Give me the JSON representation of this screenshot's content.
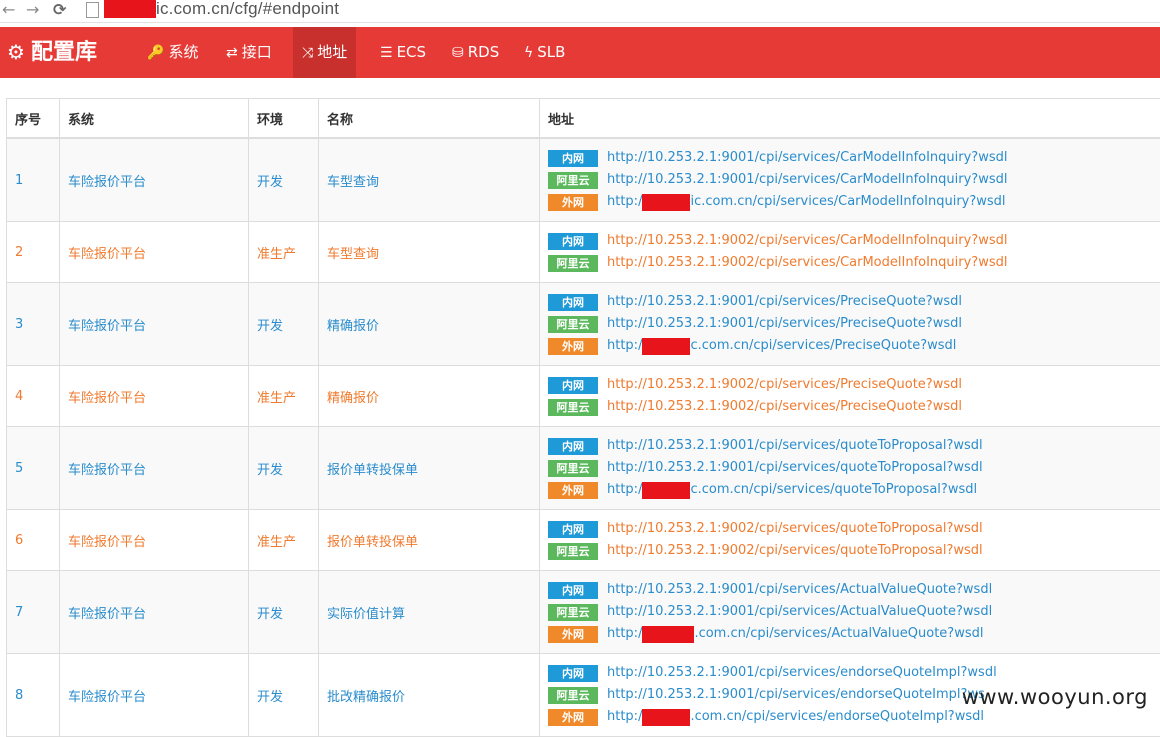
{
  "browser": {
    "url": "ic.com.cn/cfg/#endpoint",
    "back_glyph": "←",
    "forward_glyph": "→",
    "reload_glyph": "⟳"
  },
  "navbar": {
    "brand": "配置库",
    "items": [
      {
        "label": "系统",
        "icon": "key-icon",
        "glyph": "🔑"
      },
      {
        "label": "接口",
        "icon": "exchange-icon",
        "glyph": "⇄"
      },
      {
        "label": "地址",
        "icon": "random-icon",
        "glyph": "⤨"
      },
      {
        "label": "ECS",
        "icon": "server-icon",
        "glyph": "☰"
      },
      {
        "label": "RDS",
        "icon": "database-icon",
        "glyph": "⛁"
      },
      {
        "label": "SLB",
        "icon": "bolt-icon",
        "glyph": "ϟ"
      }
    ]
  },
  "table": {
    "headers": [
      "序号",
      "系统",
      "环境",
      "名称",
      "地址"
    ],
    "badges": {
      "intranet": "内网",
      "aliyun": "阿里云",
      "public": "外网"
    },
    "rows": [
      {
        "no": "1",
        "system": "车险报价平台",
        "env": "开发",
        "name": "车型查询",
        "color": "blue",
        "addrs": [
          {
            "badge": "内网",
            "type": "in",
            "url": "http://10.253.2.1:9001/cpi/services/CarModelInfoInquiry?wsdl"
          },
          {
            "badge": "阿里云",
            "type": "ali",
            "url": "http://10.253.2.1:9001/cpi/services/CarModelInfoInquiry?wsdl"
          },
          {
            "badge": "外网",
            "type": "out",
            "url_prefix": "http:/",
            "url": "ic.com.cn/cpi/services/CarModelInfoInquiry?wsdl"
          }
        ]
      },
      {
        "no": "2",
        "system": "车险报价平台",
        "env": "准生产",
        "name": "车型查询",
        "color": "orange",
        "addrs": [
          {
            "badge": "内网",
            "type": "in",
            "url": "http://10.253.2.1:9002/cpi/services/CarModelInfoInquiry?wsdl"
          },
          {
            "badge": "阿里云",
            "type": "ali",
            "url": "http://10.253.2.1:9002/cpi/services/CarModelInfoInquiry?wsdl"
          }
        ]
      },
      {
        "no": "3",
        "system": "车险报价平台",
        "env": "开发",
        "name": "精确报价",
        "color": "blue",
        "addrs": [
          {
            "badge": "内网",
            "type": "in",
            "url": "http://10.253.2.1:9001/cpi/services/PreciseQuote?wsdl"
          },
          {
            "badge": "阿里云",
            "type": "ali",
            "url": "http://10.253.2.1:9001/cpi/services/PreciseQuote?wsdl"
          },
          {
            "badge": "外网",
            "type": "out",
            "url_prefix": "http:/",
            "url": "c.com.cn/cpi/services/PreciseQuote?wsdl"
          }
        ]
      },
      {
        "no": "4",
        "system": "车险报价平台",
        "env": "准生产",
        "name": "精确报价",
        "color": "orange",
        "addrs": [
          {
            "badge": "内网",
            "type": "in",
            "url": "http://10.253.2.1:9002/cpi/services/PreciseQuote?wsdl"
          },
          {
            "badge": "阿里云",
            "type": "ali",
            "url": "http://10.253.2.1:9002/cpi/services/PreciseQuote?wsdl"
          }
        ]
      },
      {
        "no": "5",
        "system": "车险报价平台",
        "env": "开发",
        "name": "报价单转投保单",
        "color": "blue",
        "addrs": [
          {
            "badge": "内网",
            "type": "in",
            "url": "http://10.253.2.1:9001/cpi/services/quoteToProposal?wsdl"
          },
          {
            "badge": "阿里云",
            "type": "ali",
            "url": "http://10.253.2.1:9001/cpi/services/quoteToProposal?wsdl"
          },
          {
            "badge": "外网",
            "type": "out",
            "url_prefix": "http:/",
            "url": "c.com.cn/cpi/services/quoteToProposal?wsdl"
          }
        ]
      },
      {
        "no": "6",
        "system": "车险报价平台",
        "env": "准生产",
        "name": "报价单转投保单",
        "color": "orange",
        "addrs": [
          {
            "badge": "内网",
            "type": "in",
            "url": "http://10.253.2.1:9002/cpi/services/quoteToProposal?wsdl"
          },
          {
            "badge": "阿里云",
            "type": "ali",
            "url": "http://10.253.2.1:9002/cpi/services/quoteToProposal?wsdl"
          }
        ]
      },
      {
        "no": "7",
        "system": "车险报价平台",
        "env": "开发",
        "name": "实际价值计算",
        "color": "blue",
        "addrs": [
          {
            "badge": "内网",
            "type": "in",
            "url": "http://10.253.2.1:9001/cpi/services/ActualValueQuote?wsdl"
          },
          {
            "badge": "阿里云",
            "type": "ali",
            "url": "http://10.253.2.1:9001/cpi/services/ActualValueQuote?wsdl"
          },
          {
            "badge": "外网",
            "type": "out",
            "url_prefix": "http:/",
            "url": ".com.cn/cpi/services/ActualValueQuote?wsdl"
          }
        ]
      },
      {
        "no": "8",
        "system": "车险报价平台",
        "env": "开发",
        "name": "批改精确报价",
        "color": "blue",
        "addrs": [
          {
            "badge": "内网",
            "type": "in",
            "url": "http://10.253.2.1:9001/cpi/services/endorseQuoteImpl?wsdl"
          },
          {
            "badge": "阿里云",
            "type": "ali",
            "url": "http://10.253.2.1:9001/cpi/services/endorseQuoteImpl?ws"
          },
          {
            "badge": "外网",
            "type": "out",
            "url_prefix": "http:/",
            "url": ".com.cn/cpi/services/endorseQuoteImpl?wsdl"
          }
        ]
      }
    ]
  },
  "watermark": "www.wooyun.org",
  "colors": {
    "navbar": "#e63a37",
    "active_nav": "#c7302d",
    "blue_text": "#2a8ccc",
    "orange_text": "#f07a2e",
    "badge_intranet": "#1e9ad8",
    "badge_aliyun": "#5cb85c",
    "badge_public": "#f0892a",
    "redaction": "#e8141b"
  }
}
